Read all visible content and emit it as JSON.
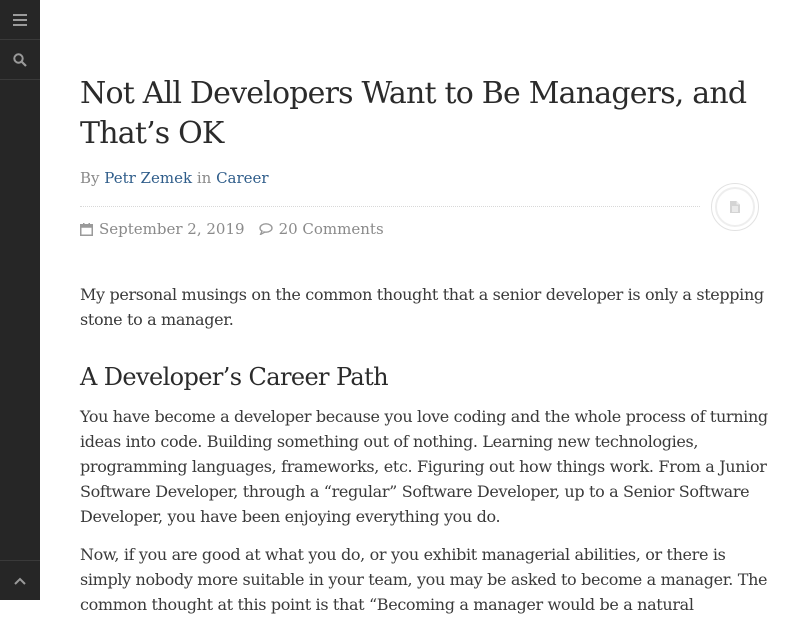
{
  "sidebar": {
    "menu_icon": "hamburger-icon",
    "search_icon": "search-icon",
    "top_icon": "chevron-up-icon"
  },
  "post": {
    "title": "Not All Developers Want to Be Managers, and That’s OK",
    "byline": {
      "by": "By",
      "author": "Petr Zemek",
      "in": "in",
      "category": "Career"
    },
    "format_icon": "document-icon",
    "date": "September 2, 2019",
    "comments": "20 Comments",
    "intro": "My personal musings on the common thought that a senior developer is only a stepping stone to a manager.",
    "section_heading": "A Developer’s Career Path",
    "paragraph1": "You have become a developer because you love coding and the whole process of turning ideas into code. Building something out of nothing. Learning new technologies, programming languages, frameworks, etc. Figuring out how things work. From a Junior Software Developer, through a “regular” Software Developer, up to a Senior Software Developer, you have been enjoying everything you do.",
    "paragraph2": "Now, if you are good at what you do, or you exhibit managerial abilities, or there is simply nobody more suitable in your team, you may be asked to become a manager. The common thought at this point is that “Becoming a manager would be a natural"
  },
  "colors": {
    "sidebar_bg": "#262626",
    "link": "#2f5d8a",
    "meta_gray": "#8a8a8a"
  }
}
